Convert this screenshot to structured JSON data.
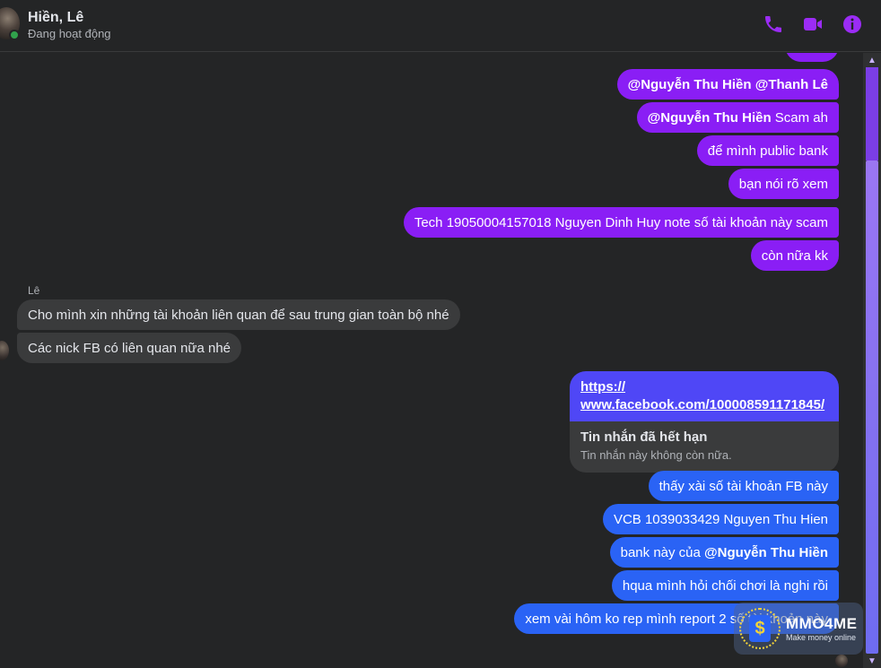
{
  "header": {
    "name": "Hiền, Lê",
    "status": "Đang hoạt động",
    "icons": {
      "call": "phone-icon",
      "video": "video-icon",
      "info": "info-icon"
    },
    "accent_color": "#9b2cf5"
  },
  "messages_top": [
    {
      "parts": [
        {
          "bold": true,
          "text": "@Nguyễn Thu Hiền"
        },
        {
          "bold": false,
          "text": " "
        },
        {
          "bold": true,
          "text": "@Thanh Lê"
        }
      ]
    },
    {
      "parts": [
        {
          "bold": true,
          "text": "@Nguyễn Thu Hiền"
        },
        {
          "bold": false,
          "text": " Scam ah"
        }
      ]
    },
    {
      "parts": [
        {
          "bold": false,
          "text": "để mình public bank"
        }
      ]
    },
    {
      "parts": [
        {
          "bold": false,
          "text": "bạn nói rõ xem"
        }
      ]
    },
    {
      "parts": [
        {
          "bold": false,
          "text": "Tech 19050004157018 Nguyen Dinh Huy note số tài khoản này scam"
        }
      ]
    },
    {
      "parts": [
        {
          "bold": false,
          "text": "còn nữa kk"
        }
      ]
    }
  ],
  "incoming": {
    "sender": "Lê",
    "messages": [
      "Cho mình xin những tài khoản liên quan để sau trung gian toàn bộ nhé",
      "Các nick FB có liên quan nữa nhé"
    ]
  },
  "link_card": {
    "url_line1": "https://",
    "url_line2": "www.facebook.com/100008591171845/",
    "expired_title": "Tin nhắn đã hết hạn",
    "expired_sub": "Tin nhắn này không còn nữa."
  },
  "messages_bottom": [
    {
      "parts": [
        {
          "bold": false,
          "text": "thấy xài số tài khoản FB này"
        }
      ]
    },
    {
      "parts": [
        {
          "bold": false,
          "text": "VCB 1039033429 Nguyen Thu Hien"
        }
      ]
    },
    {
      "parts": [
        {
          "bold": false,
          "text": "bank này của "
        },
        {
          "bold": true,
          "text": "@Nguyễn Thu Hiền"
        }
      ]
    },
    {
      "parts": [
        {
          "bold": false,
          "text": "hqua mình hỏi chối chơi là nghi rồi"
        }
      ]
    },
    {
      "parts": [
        {
          "bold": false,
          "text": "xem vài hôm ko rep mình report 2 số tài khoản này"
        }
      ]
    }
  ],
  "watermark": {
    "title": "MMO4ME",
    "subtitle": "Make money online"
  }
}
